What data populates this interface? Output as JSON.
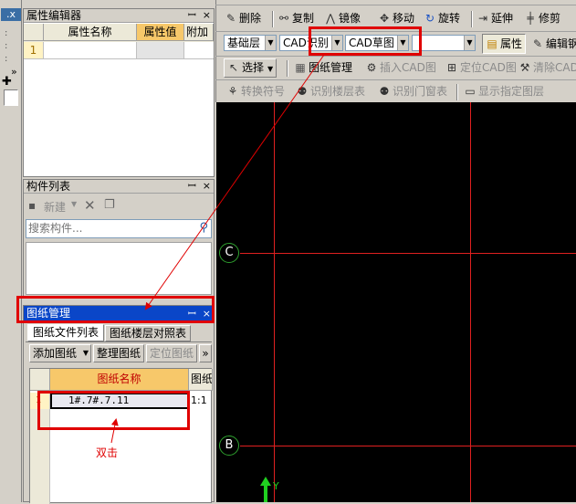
{
  "left_strip": {
    "btn_x": ".x"
  },
  "property_panel": {
    "title": "属性编辑器",
    "pin": "ꟷ",
    "close": "×",
    "columns": [
      "属性名称",
      "属性值",
      "附加"
    ],
    "rows": [
      {
        "index": "1",
        "name": "",
        "value": "",
        "extra": ""
      }
    ]
  },
  "component_panel": {
    "title": "构件列表",
    "new_label": "新建",
    "search_placeholder": "搜索构件..."
  },
  "drawing_panel": {
    "title": "图纸管理",
    "tabs": [
      "图纸文件列表",
      "图纸楼层对照表"
    ],
    "buttons": [
      "添加图纸",
      "整理图纸",
      "定位图纸"
    ],
    "more": "»",
    "columns": [
      "图纸名称",
      "图纸"
    ],
    "rows": [
      {
        "name": "1#.7#.7.11",
        "scale": "1:1"
      }
    ],
    "annotation": "双击"
  },
  "toolbar1": {
    "delete": "删除",
    "copy": "复制",
    "mirror": "镜像",
    "move": "移动",
    "rotate": "旋转",
    "extend": "延伸",
    "trim": "修剪"
  },
  "toolbar2": {
    "floor": "基础层",
    "cad_recog": "CAD识别",
    "cad_draft": "CAD草图",
    "empty": "",
    "properties": "属性",
    "edit": "编辑钢"
  },
  "toolbar3": {
    "select": "选择",
    "drawing_mgmt": "图纸管理",
    "insert_cad": "插入CAD图",
    "locate_cad": "定位CAD图",
    "clear_cad": "清除CAD"
  },
  "toolbar4": {
    "convert_symbol": "转换符号",
    "recog_floor": "识别楼层表",
    "recog_window": "识别门窗表",
    "show_layer": "显示指定图层"
  },
  "canvas": {
    "axis_c": "C",
    "axis_b": "B",
    "y_label": "Y"
  }
}
